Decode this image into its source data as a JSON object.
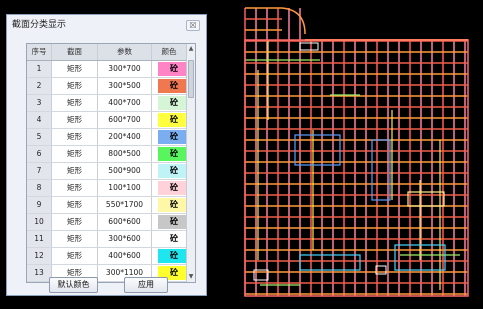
{
  "dialog": {
    "title": "截面分类显示",
    "close_label": "☒",
    "columns": [
      "序号",
      "截面",
      "参数",
      "颜色"
    ],
    "rows": [
      {
        "no": "1",
        "shape": "矩形",
        "param": "300*700",
        "color": "#ff84c6",
        "label": "砼"
      },
      {
        "no": "2",
        "shape": "矩形",
        "param": "300*500",
        "color": "#f07850",
        "label": "砼"
      },
      {
        "no": "3",
        "shape": "矩形",
        "param": "400*700",
        "color": "#d6f5d6",
        "label": "砼"
      },
      {
        "no": "4",
        "shape": "矩形",
        "param": "600*700",
        "color": "#ffff40",
        "label": "砼"
      },
      {
        "no": "5",
        "shape": "矩形",
        "param": "200*400",
        "color": "#7aaef0",
        "label": "砼"
      },
      {
        "no": "6",
        "shape": "矩形",
        "param": "800*500",
        "color": "#59f55f",
        "label": "砼"
      },
      {
        "no": "7",
        "shape": "矩形",
        "param": "500*900",
        "color": "#bff3f6",
        "label": "砼"
      },
      {
        "no": "8",
        "shape": "矩形",
        "param": "100*100",
        "color": "#ffd1d8",
        "label": "砼"
      },
      {
        "no": "9",
        "shape": "矩形",
        "param": "550*1700",
        "color": "#fff7a8",
        "label": "砼"
      },
      {
        "no": "10",
        "shape": "矩形",
        "param": "600*600",
        "color": "#c7c7c7",
        "label": "砼"
      },
      {
        "no": "11",
        "shape": "矩形",
        "param": "300*600",
        "color": "#ffffff",
        "label": "砼"
      },
      {
        "no": "12",
        "shape": "矩形",
        "param": "400*600",
        "color": "#1fe6ee",
        "label": "砼"
      },
      {
        "no": "13",
        "shape": "矩形",
        "param": "300*1100",
        "color": "#ffff2e",
        "label": "砼"
      }
    ],
    "buttons": {
      "default_color": "默认颜色",
      "apply": "应用"
    }
  }
}
